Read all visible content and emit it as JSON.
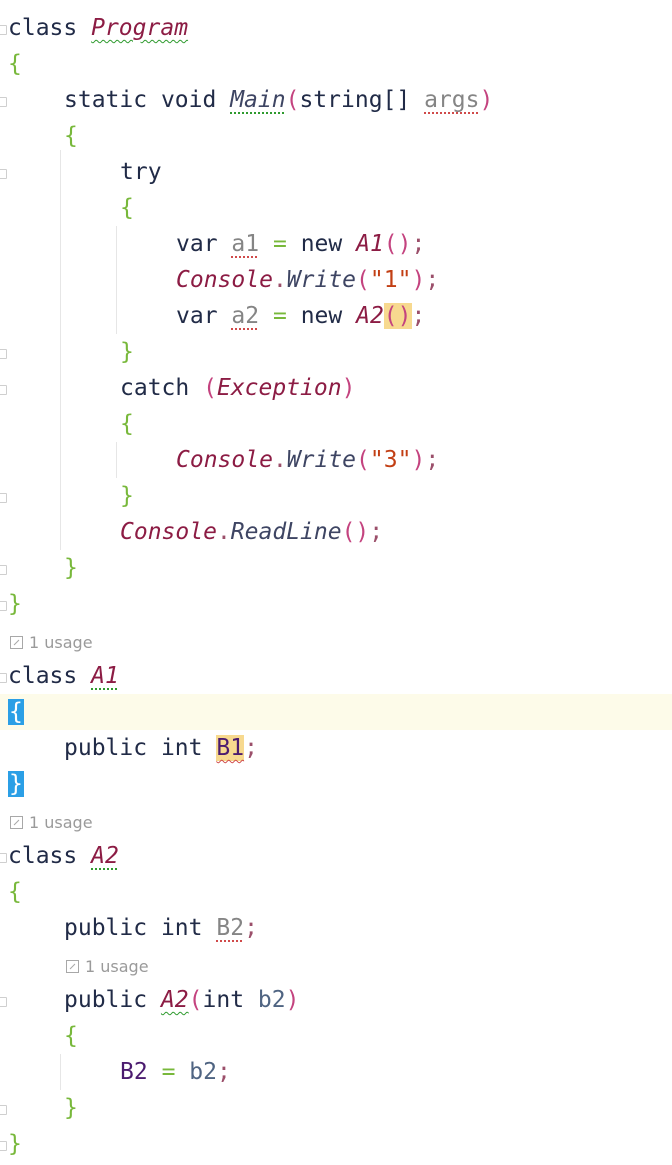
{
  "program": {
    "class_kw": "class",
    "class_name": "Program",
    "open_brace": "{",
    "main_static": "static",
    "main_void": "void",
    "main_name": "Main",
    "main_open": "(",
    "main_type": "string[]",
    "main_arg": "args",
    "main_close": ")",
    "main_open_brace": "{",
    "try_kw": "try",
    "try_open_brace": "{",
    "line1_var": "var",
    "line1_name": "a1",
    "line1_eq": "=",
    "line1_new": "new",
    "line1_class": "A1",
    "line1_parens": "()",
    "line1_semi": ";",
    "write1_class": "Console",
    "write1_dot": ".",
    "write1_method": "Write",
    "write1_open": "(",
    "write1_arg": "\"1\"",
    "write1_close": ")",
    "write1_semi": ";",
    "line2_var": "var",
    "line2_name": "a2",
    "line2_eq": "=",
    "line2_new": "new",
    "line2_class": "A2",
    "line2_parens": "()",
    "line2_semi": ";",
    "try_close_brace": "}",
    "catch_kw": "catch",
    "catch_open": "(",
    "catch_type": "Exception",
    "catch_close": ")",
    "catch_open_brace": "{",
    "write3_class": "Console",
    "write3_dot": ".",
    "write3_method": "Write",
    "write3_open": "(",
    "write3_arg": "\"3\"",
    "write3_close": ")",
    "write3_semi": ";",
    "catch_close_brace": "}",
    "readline_class": "Console",
    "readline_dot": ".",
    "readline_method": "ReadLine",
    "readline_parens": "()",
    "readline_semi": ";",
    "main_close_brace": "}",
    "close_brace": "}"
  },
  "a1": {
    "usage_hint": "1 usage",
    "class_kw": "class",
    "class_name": "A1",
    "open_brace": "{",
    "field_public": "public",
    "field_type": "int",
    "field_name": "B1",
    "field_semi": ";",
    "close_brace": "}"
  },
  "a2": {
    "usage_hint": "1 usage",
    "class_kw": "class",
    "class_name": "A2",
    "open_brace": "{",
    "field_public": "public",
    "field_type": "int",
    "field_name": "B2",
    "field_semi": ";",
    "ctor_usage_hint": "1 usage",
    "ctor_public": "public",
    "ctor_name": "A2",
    "ctor_open": "(",
    "ctor_type": "int",
    "ctor_param": "b2",
    "ctor_close": ")",
    "ctor_open_brace": "{",
    "assign_field": "B2",
    "assign_eq": "=",
    "assign_value": "b2",
    "assign_semi": ";",
    "ctor_close_brace": "}",
    "close_brace": "}"
  },
  "colors": {
    "keyword": "#212b47",
    "class_name": "#8c1c44",
    "string": "#c23f14",
    "brace": "#78b83b",
    "current_line": "#fdfbe9",
    "brace_match": "#2b9fe6",
    "paren_match": "#f7d98f"
  },
  "icons": {
    "usage_hint": "usage-arrow-icon",
    "fold_marker": "fold-marker-icon"
  }
}
